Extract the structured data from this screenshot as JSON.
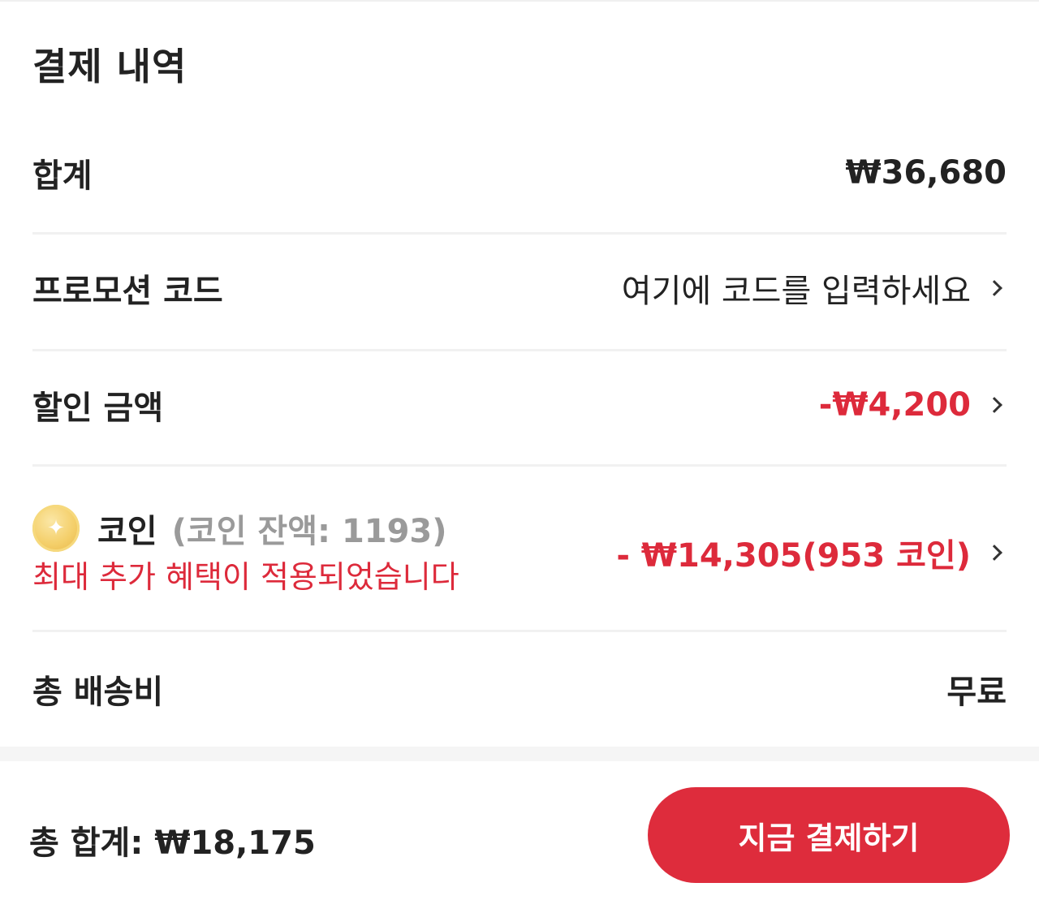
{
  "header": {
    "title": "결제 내역"
  },
  "rows": {
    "subtotal": {
      "label": "합계",
      "value": "₩36,680"
    },
    "promo": {
      "label": "프로모션 코드",
      "value": "여기에 코드를 입력하세요"
    },
    "discount": {
      "label": "할인 금액",
      "value": "-₩4,200"
    },
    "coin": {
      "label": "코인",
      "balance": "(코인 잔액: 1193)",
      "note": "최대 추가 혜택이 적용되었습니다",
      "value": "- ₩14,305(953 코인)"
    },
    "shipping": {
      "label": "총 배송비",
      "value": "무료"
    }
  },
  "footer": {
    "total_label": "총 합계:",
    "total_amount": "₩18,175",
    "pay_button": "지금 결제하기"
  },
  "icons": {
    "coin": "coin-icon",
    "chevron": "chevron-right-icon"
  },
  "colors": {
    "accent": "#de2c3c",
    "muted": "#9a9a9a"
  }
}
